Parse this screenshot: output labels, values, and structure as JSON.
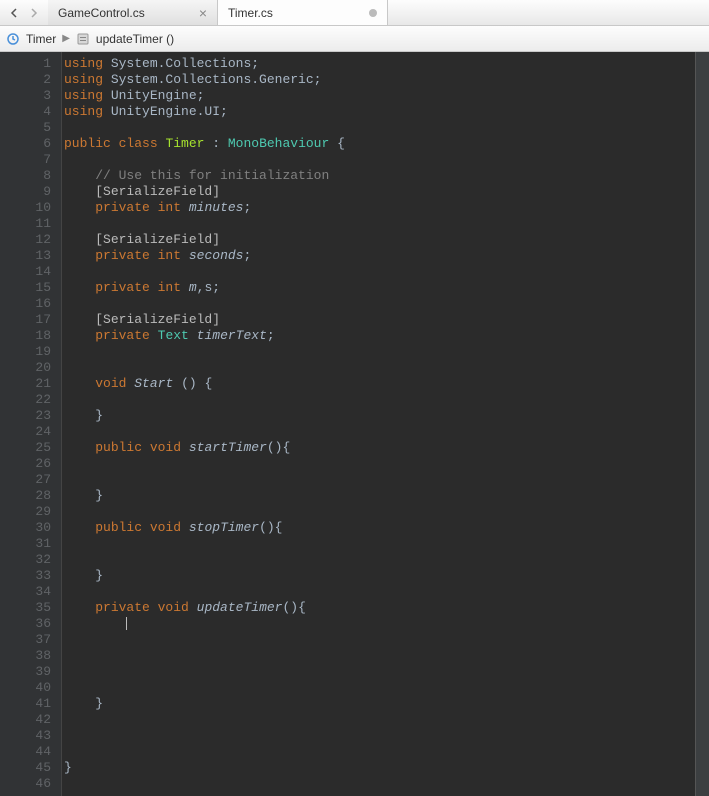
{
  "tabs": [
    {
      "label": "GameControl.cs",
      "active": false,
      "modified": false
    },
    {
      "label": "Timer.cs",
      "active": true,
      "modified": true
    }
  ],
  "breadcrumb": {
    "class": "Timer",
    "method": "updateTimer ()"
  },
  "code": {
    "lines": 46,
    "content": [
      {
        "n": 1,
        "t": "using",
        "r": " System.Collections;"
      },
      {
        "n": 2,
        "t": "using",
        "r": " System.Collections.Generic;"
      },
      {
        "n": 3,
        "t": "using",
        "r": " UnityEngine;"
      },
      {
        "n": 4,
        "t": "using",
        "r": " UnityEngine.UI;"
      },
      {
        "n": 5,
        "blank": true
      },
      {
        "n": 6,
        "raw": "public class Timer : MonoBehaviour {"
      },
      {
        "n": 7,
        "blank": true
      },
      {
        "n": 8,
        "indent": 1,
        "comment": "// Use this for initialization"
      },
      {
        "n": 9,
        "indent": 1,
        "attr": "[SerializeField]"
      },
      {
        "n": 10,
        "indent": 1,
        "decl": "private int",
        "ident": "minutes",
        "tail": ";"
      },
      {
        "n": 11,
        "blank": true
      },
      {
        "n": 12,
        "indent": 1,
        "attr": "[SerializeField]"
      },
      {
        "n": 13,
        "indent": 1,
        "decl": "private int",
        "ident": "seconds",
        "tail": ";"
      },
      {
        "n": 14,
        "blank": true
      },
      {
        "n": 15,
        "indent": 1,
        "decl": "private int",
        "ident": "m",
        "tail": ",s;"
      },
      {
        "n": 16,
        "blank": true
      },
      {
        "n": 17,
        "indent": 1,
        "attr": "[SerializeField]"
      },
      {
        "n": 18,
        "indent": 1,
        "decl": "private",
        "type": "Text",
        "ident": "timerText",
        "tail": ";"
      },
      {
        "n": 19,
        "blank": true
      },
      {
        "n": 20,
        "blank": true
      },
      {
        "n": 21,
        "indent": 1,
        "decl": "void",
        "ident": "Start",
        "tail": " () {"
      },
      {
        "n": 22,
        "blank": true
      },
      {
        "n": 23,
        "indent": 1,
        "plain": "}"
      },
      {
        "n": 24,
        "blank": true
      },
      {
        "n": 25,
        "indent": 1,
        "decl": "public void",
        "ident": "startTimer",
        "tail": "(){"
      },
      {
        "n": 26,
        "blank": true
      },
      {
        "n": 27,
        "blank": true
      },
      {
        "n": 28,
        "indent": 1,
        "plain": "}"
      },
      {
        "n": 29,
        "blank": true
      },
      {
        "n": 30,
        "indent": 1,
        "decl": "public void",
        "ident": "stopTimer",
        "tail": "(){"
      },
      {
        "n": 31,
        "blank": true
      },
      {
        "n": 32,
        "blank": true
      },
      {
        "n": 33,
        "indent": 1,
        "plain": "}"
      },
      {
        "n": 34,
        "blank": true
      },
      {
        "n": 35,
        "indent": 1,
        "decl": "private void",
        "ident": "updateTimer",
        "tail": "(){"
      },
      {
        "n": 36,
        "indent": 2,
        "caret": true
      },
      {
        "n": 37,
        "blank": true
      },
      {
        "n": 38,
        "blank": true
      },
      {
        "n": 39,
        "blank": true
      },
      {
        "n": 40,
        "blank": true
      },
      {
        "n": 41,
        "indent": 1,
        "plain": "}"
      },
      {
        "n": 42,
        "blank": true
      },
      {
        "n": 43,
        "blank": true
      },
      {
        "n": 44,
        "blank": true
      },
      {
        "n": 45,
        "plain": "}"
      },
      {
        "n": 46,
        "blank": true
      }
    ]
  }
}
